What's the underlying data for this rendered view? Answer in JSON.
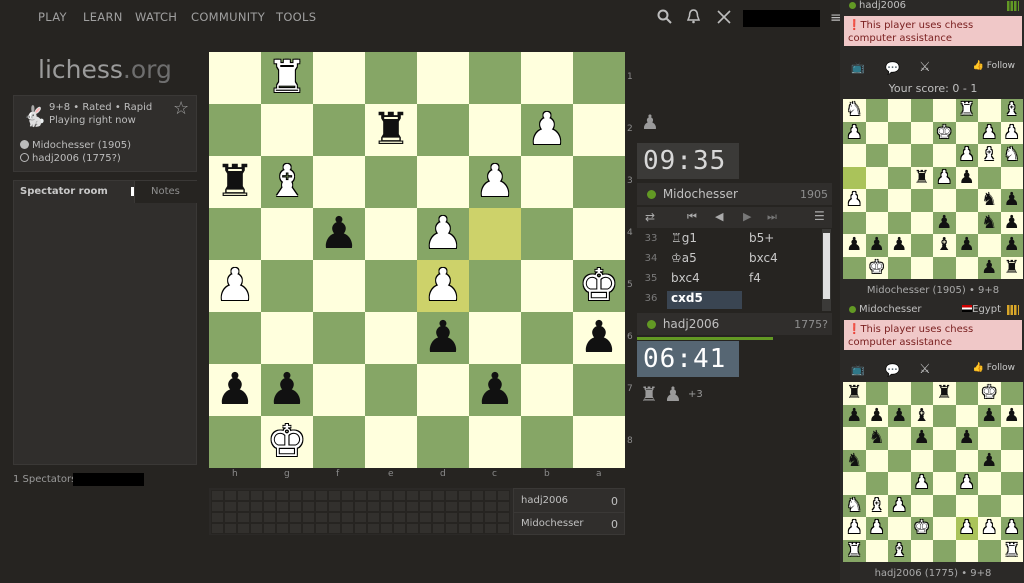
{
  "nav": {
    "play": "PLAY",
    "learn": "LEARN",
    "watch": "WATCH",
    "community": "COMMUNITY",
    "tools": "TOOLS"
  },
  "logo": {
    "main": "lichess",
    "suffix": ".org"
  },
  "game_info": {
    "line1": "9+8 • Rated • Rapid",
    "line2": "Playing right now",
    "white_player": "Midochesser (1905)",
    "black_player": "hadj2006 (1775?)"
  },
  "spectator": {
    "tab_room": "Spectator room",
    "tab_notes": "Notes",
    "count": "1 Spectators"
  },
  "ranks": [
    "1",
    "2",
    "3",
    "4",
    "5",
    "6",
    "7",
    "8"
  ],
  "files": [
    "h",
    "g",
    "f",
    "e",
    "d",
    "c",
    "b",
    "a"
  ],
  "board": {
    "orientation": "black",
    "pieces": [
      {
        "sq": "g1",
        "piece": "♜",
        "color": "w"
      },
      {
        "sq": "e2",
        "piece": "♜",
        "color": "b"
      },
      {
        "sq": "b2",
        "piece": "♟",
        "color": "w"
      },
      {
        "sq": "h3",
        "piece": "♜",
        "color": "b"
      },
      {
        "sq": "g3",
        "piece": "♝",
        "color": "w"
      },
      {
        "sq": "c3",
        "piece": "♟",
        "color": "w"
      },
      {
        "sq": "f4",
        "piece": "♟",
        "color": "b"
      },
      {
        "sq": "d4",
        "piece": "♟",
        "color": "w"
      },
      {
        "sq": "h5",
        "piece": "♟",
        "color": "w"
      },
      {
        "sq": "d5",
        "piece": "♟",
        "color": "w"
      },
      {
        "sq": "a5",
        "piece": "♚",
        "color": "w"
      },
      {
        "sq": "d6",
        "piece": "♟",
        "color": "b"
      },
      {
        "sq": "a6",
        "piece": "♟",
        "color": "b"
      },
      {
        "sq": "h7",
        "piece": "♟",
        "color": "b"
      },
      {
        "sq": "g7",
        "piece": "♟",
        "color": "b"
      },
      {
        "sq": "c7",
        "piece": "♟",
        "color": "b"
      },
      {
        "sq": "g8",
        "piece": "♚",
        "color": "w"
      }
    ],
    "highlight": [
      "c4",
      "d5"
    ]
  },
  "clocks": {
    "top": "09:35",
    "bottom": "06:41"
  },
  "players": {
    "top_name": "Midochesser",
    "top_rating": "1905",
    "bottom_name": "hadj2006",
    "bottom_rating": "1775?"
  },
  "moves": [
    {
      "n": "33",
      "w": "♖g1",
      "b": "b5+"
    },
    {
      "n": "34",
      "w": "♔a5",
      "b": "bxc4"
    },
    {
      "n": "35",
      "w": "bxc4",
      "b": "f4"
    },
    {
      "n": "36",
      "w": "cxd5",
      "b": ""
    }
  ],
  "material": {
    "plus": "+3"
  },
  "results": [
    {
      "name": "hadj2006",
      "score": "0"
    },
    {
      "name": "Midochesser",
      "score": "0"
    }
  ],
  "right_top": {
    "player": "hadj2006",
    "warning": "This player uses chess computer assistance",
    "follow": "Follow",
    "score_label": "Your score: 0 - 1",
    "caption": "Midochesser (1905) • 9+8"
  },
  "right_bottom": {
    "player": "Midochesser",
    "country": "Egypt",
    "warning": "This player uses chess computer assistance",
    "follow": "Follow",
    "caption": "hadj2006 (1775) • 9+8"
  },
  "colors": {
    "accent_green": "#629924",
    "light_sq": "#ffffdd",
    "dark_sq": "#86a666",
    "warning_bg": "#f0c8c8"
  }
}
